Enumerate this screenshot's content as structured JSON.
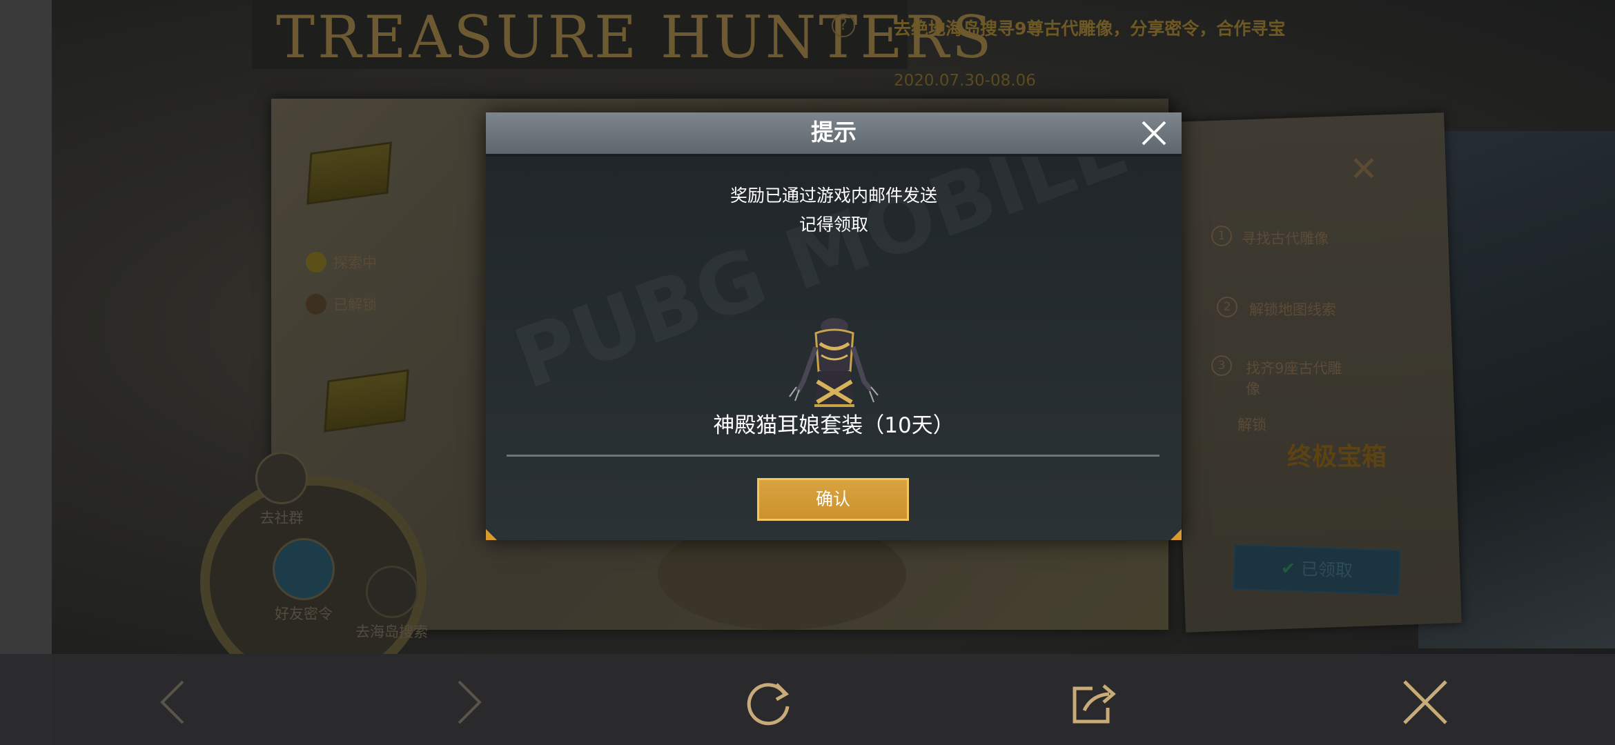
{
  "event": {
    "title": "TREASURE HUNTERS",
    "subtitle": "去绝地海岛搜寻9尊古代雕像，分享密令，合作寻宝",
    "dates": "2020.07.30-08.06",
    "map_status_exploring": "探索中",
    "map_status_unlocked": "已解锁",
    "steps": [
      {
        "num": "1",
        "label": "寻找古代雕像"
      },
      {
        "num": "2",
        "label": "解锁地图线索"
      },
      {
        "num": "3",
        "label": "找齐9座古代雕\n像"
      }
    ],
    "unlock_label": "解锁",
    "final_chest": "终极宝箱",
    "claimed_label": "已领取",
    "wheel": {
      "community": "去社群",
      "friend_code": "好友密令",
      "island_search": "去海岛搜索"
    }
  },
  "dialog": {
    "title": "提示",
    "message_line1": "奖励已通过游戏内邮件发送",
    "message_line2": "记得领取",
    "watermark": "PUBG MOBILE",
    "reward_name": "神殿猫耳娘套装（10天）",
    "confirm_label": "确认"
  },
  "toolbar": {
    "icons": [
      "back-icon",
      "forward-icon",
      "refresh-icon",
      "share-icon",
      "close-icon"
    ]
  },
  "colors": {
    "confirm": "#d9a33f",
    "toolbar_icon_active": "#c9ab7a",
    "toolbar_icon_disabled": "#5a554a"
  }
}
